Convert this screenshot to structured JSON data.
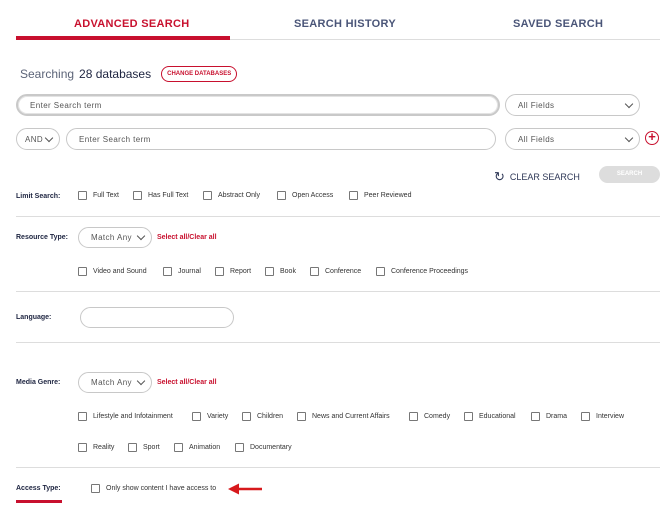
{
  "tabs": {
    "advanced": "ADVANCED SEARCH",
    "history": "SEARCH HISTORY",
    "saved": "SAVED SEARCH"
  },
  "searching": {
    "prefix": "Searching",
    "databases": "28 databases",
    "change_button": "CHANGE DATABASES"
  },
  "search_row1": {
    "placeholder": "Enter Search term",
    "field": "All Fields"
  },
  "search_row2": {
    "operator": "AND",
    "placeholder": "Enter Search term",
    "field": "All Fields"
  },
  "actions": {
    "clear": "CLEAR SEARCH",
    "search": "SEARCH"
  },
  "limit_search": {
    "label": "Limit Search:",
    "options": [
      "Full Text",
      "Has Full Text",
      "Abstract Only",
      "Open Access",
      "Peer Reviewed"
    ]
  },
  "resource_type": {
    "label": "Resource Type:",
    "match": "Match Any",
    "select_all": "Select all/Clear all",
    "options": [
      "Video and Sound",
      "Journal",
      "Report",
      "Book",
      "Conference",
      "Conference Proceedings"
    ]
  },
  "language": {
    "label": "Language:"
  },
  "media_genre": {
    "label": "Media Genre:",
    "match": "Match Any",
    "select_all": "Select all/Clear all",
    "options_row1": [
      "Lifestyle and Infotainment",
      "Variety",
      "Children",
      "News and Current Affairs",
      "Comedy",
      "Educational",
      "Drama",
      "Interview"
    ],
    "options_row2": [
      "Reality",
      "Sport",
      "Animation",
      "Documentary"
    ]
  },
  "access_type": {
    "label": "Access Type:",
    "option": "Only show content I have access to"
  },
  "colors": {
    "accent": "#c8102e",
    "navy": "#1d2440"
  }
}
